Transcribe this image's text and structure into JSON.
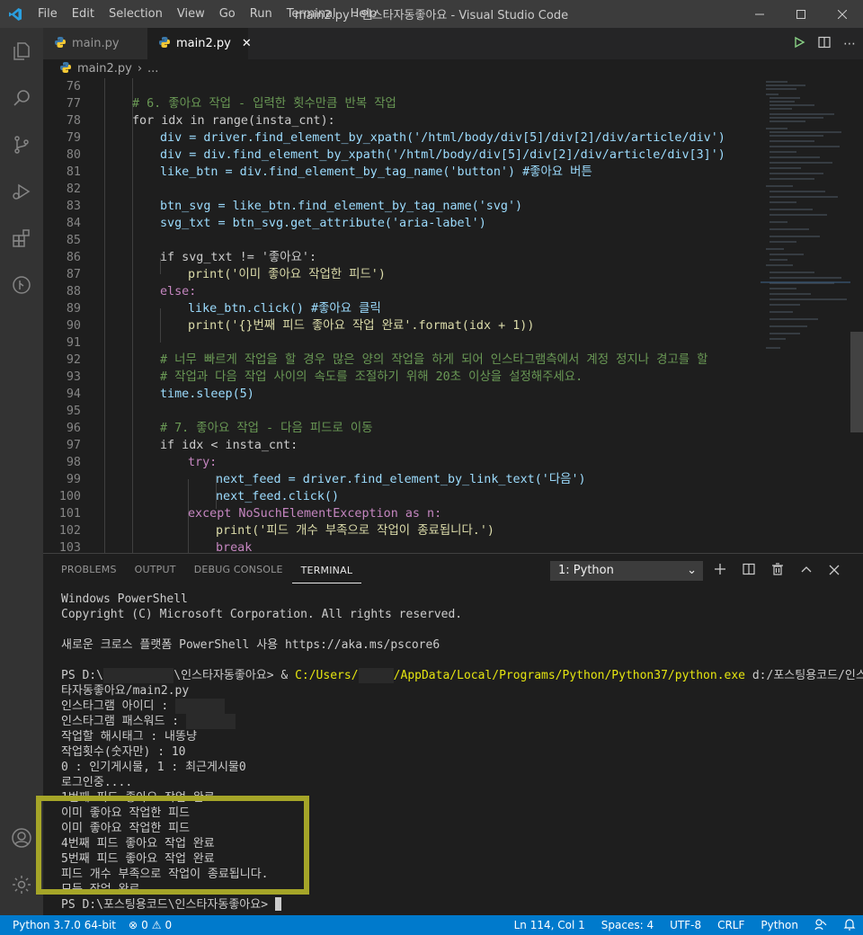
{
  "window": {
    "title": "main2.py - 인스타자동좋아요 - Visual Studio Code",
    "menu": [
      "File",
      "Edit",
      "Selection",
      "View",
      "Go",
      "Run",
      "Terminal",
      "Help"
    ]
  },
  "tabs": [
    {
      "label": "main.py",
      "active": false
    },
    {
      "label": "main2.py",
      "active": true
    }
  ],
  "breadcrumb": {
    "file": "main2.py",
    "more": "..."
  },
  "editor": {
    "lines": [
      {
        "n": "76",
        "t": ""
      },
      {
        "n": "77",
        "t": "# 6. 좋아요 작업 - 입력한 횟수만큼 반복 작업"
      },
      {
        "n": "78",
        "t": "for idx in range(insta_cnt):"
      },
      {
        "n": "79",
        "t": "div = driver.find_element_by_xpath('/html/body/div[5]/div[2]/div/article/div')"
      },
      {
        "n": "80",
        "t": "div = div.find_element_by_xpath('/html/body/div[5]/div[2]/div/article/div[3]')"
      },
      {
        "n": "81",
        "t": "like_btn = div.find_element_by_tag_name('button') #좋아요 버튼"
      },
      {
        "n": "82",
        "t": ""
      },
      {
        "n": "83",
        "t": "btn_svg = like_btn.find_element_by_tag_name('svg')"
      },
      {
        "n": "84",
        "t": "svg_txt = btn_svg.get_attribute('aria-label')"
      },
      {
        "n": "85",
        "t": ""
      },
      {
        "n": "86",
        "t": "if svg_txt != '좋아요':"
      },
      {
        "n": "87",
        "t": "print('이미 좋아요 작업한 피드')"
      },
      {
        "n": "88",
        "t": "else:"
      },
      {
        "n": "89",
        "t": "like_btn.click() #좋아요 클릭"
      },
      {
        "n": "90",
        "t": "print('{}번째 피드 좋아요 작업 완료'.format(idx + 1))"
      },
      {
        "n": "91",
        "t": ""
      },
      {
        "n": "92",
        "t": "# 너무 빠르게 작업을 할 경우 많은 양의 작업을 하게 되어 인스타그램측에서 계정 정지나 경고를 할"
      },
      {
        "n": "93",
        "t": "# 작업과 다음 작업 사이의 속도를 조절하기 위해 20초 이상을 설정해주세요."
      },
      {
        "n": "94",
        "t": "time.sleep(5)"
      },
      {
        "n": "95",
        "t": ""
      },
      {
        "n": "96",
        "t": "# 7. 좋아요 작업 - 다음 피드로 이동"
      },
      {
        "n": "97",
        "t": "if idx < insta_cnt:"
      },
      {
        "n": "98",
        "t": "try:"
      },
      {
        "n": "99",
        "t": "next_feed = driver.find_element_by_link_text('다음')"
      },
      {
        "n": "100",
        "t": "next_feed.click()"
      },
      {
        "n": "101",
        "t": "except NoSuchElementException as n:"
      },
      {
        "n": "102",
        "t": "print('피드 개수 부족으로 작업이 종료됩니다.')"
      },
      {
        "n": "103",
        "t": "break"
      }
    ]
  },
  "panel": {
    "tabs": [
      "PROBLEMS",
      "OUTPUT",
      "DEBUG CONSOLE",
      "TERMINAL"
    ],
    "active_tab": "TERMINAL",
    "terminal_select": "1: Python",
    "terminal": {
      "l1": "Windows PowerShell",
      "l2": "Copyright (C) Microsoft Corporation. All rights reserved.",
      "l3": "새로운 크로스 플랫폼 PowerShell 사용 https://aka.ms/pscore6",
      "prompt_prefix": "PS D:\\",
      "prompt_suffix": "\\인스타자동좋아요> & ",
      "py_path_a": "C:/Users/",
      "py_path_b": "/AppData/Local/Programs/Python/Python37/python.exe",
      "script_path_a": " d:/포스팅용코드/인스",
      "script_path_b": "타자동좋아요/main2.py",
      "out": [
        "인스타그램 아이디 : ",
        "인스타그램 패스워드 : ",
        "작업할 해시태그 : 내똥냥",
        "작업횟수(숫자만) : 10",
        "0 : 인기게시물, 1 : 최근게시물0",
        "로그인중....",
        "1번째 피드 좋아요 작업 완료",
        "이미 좋아요 작업한 피드",
        "이미 좋아요 작업한 피드",
        "4번째 피드 좋아요 작업 완료",
        "5번째 피드 좋아요 작업 완료",
        "피드 개수 부족으로 작업이 종료됩니다.",
        "모든 작업 완료"
      ],
      "final_prompt": "PS D:\\포스팅용코드\\인스타자동좋아요>"
    }
  },
  "statusbar": {
    "python": "Python 3.7.0 64-bit",
    "errors": "0",
    "warnings": "0",
    "position": "Ln 114, Col 1",
    "spaces": "Spaces: 4",
    "encoding": "UTF-8",
    "eol": "CRLF",
    "language": "Python"
  },
  "colors": {
    "accent": "#007acc",
    "highlight_box": "#a5a528"
  }
}
